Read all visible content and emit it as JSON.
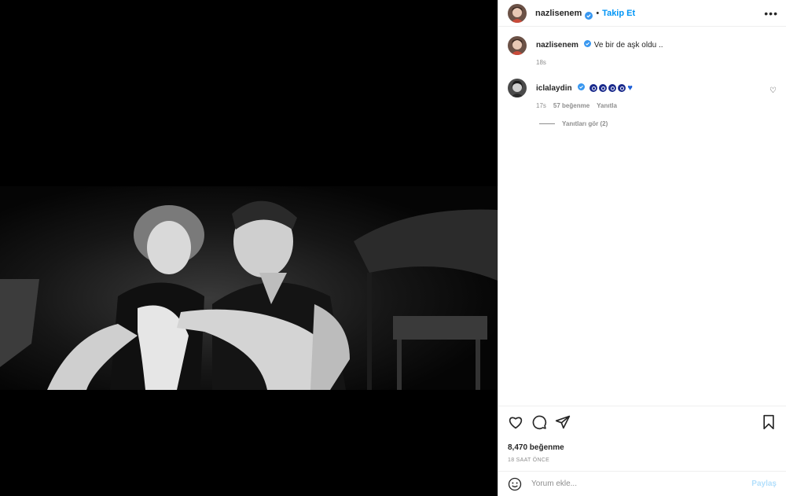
{
  "post": {
    "author": "nazlisenem",
    "follow_label": "Takip Et",
    "separator": "•",
    "more_icon": "•••",
    "caption": "Ve bir de aşk oldu ..",
    "caption_time": "18s"
  },
  "comments": [
    {
      "username": "iclalaydin",
      "time": "17s",
      "likes": "57 beğenme",
      "reply_label": "Yanıtla",
      "view_replies": "Yanıtları gör (2)",
      "emoji_count": 4
    }
  ],
  "footer": {
    "likes": "8,470 beğenme",
    "timestamp": "18 SAAT ÖNCE",
    "comment_placeholder": "Yorum ekle...",
    "post_label": "Paylaş"
  },
  "colors": {
    "accent": "#0095f6",
    "verified": "#3897f0",
    "post_disabled": "#b2dffc"
  }
}
